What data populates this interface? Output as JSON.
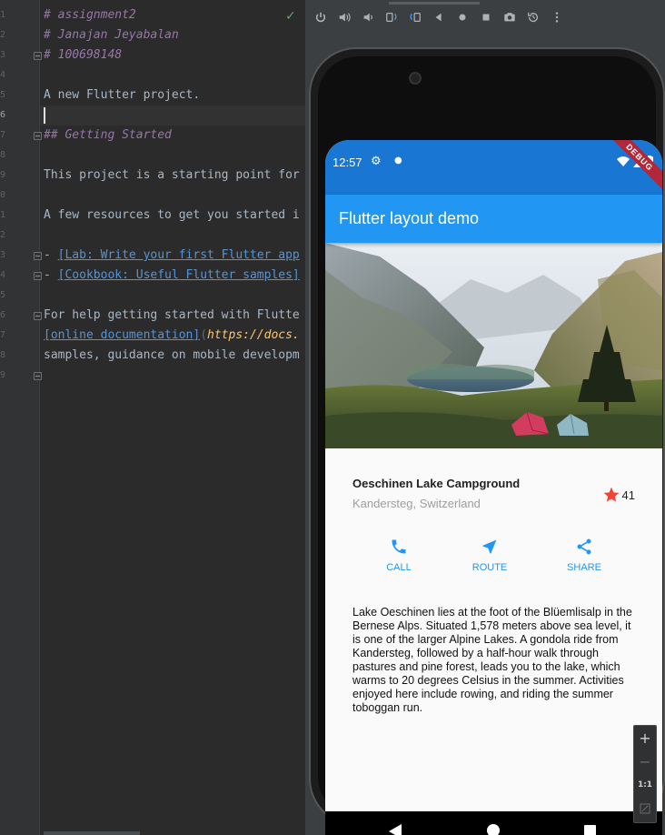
{
  "editor": {
    "line_numbers": [
      "1",
      "2",
      "3",
      "4",
      "5",
      "6",
      "7",
      "8",
      "9",
      "0",
      "1",
      "2",
      "3",
      "4",
      "5",
      "6",
      "7",
      "8",
      "9"
    ],
    "lines": {
      "l1": "# assignment2",
      "l2": "# Janajan Jeyabalan",
      "l3": "# 100698148",
      "l5": "A new Flutter project.",
      "l7": "## Getting Started",
      "l9": "This project is a starting point for",
      "l11": "A few resources to get you started i",
      "l13_prefix": "- ",
      "l13_link": "[Lab: Write your first Flutter app",
      "l14_prefix": "- ",
      "l14_link": "[Cookbook: Useful Flutter samples]",
      "l16": "For help getting started with Flutte",
      "l17_link": "[online documentation]",
      "l17_paren": "(",
      "l17_url": "https://docs.",
      "l18": "samples, guidance on mobile developm"
    },
    "status_icon": "checkmark-icon"
  },
  "emulator": {
    "toolbar": [
      "power-icon",
      "volume-up-icon",
      "volume-down-icon",
      "rotate-left-icon",
      "rotate-right-icon",
      "back-icon",
      "home-icon",
      "overview-icon",
      "screenshot-icon",
      "snapshot-icon",
      "more-icon"
    ]
  },
  "phone": {
    "status_time": "12:57",
    "debug_banner": "DEBUG",
    "appbar_title": "Flutter layout demo",
    "place_name": "Oeschinen Lake Campground",
    "place_location": "Kandersteg, Switzerland",
    "favorite_count": "41",
    "actions": [
      {
        "label": "CALL",
        "icon": "phone-icon"
      },
      {
        "label": "ROUTE",
        "icon": "navigation-icon"
      },
      {
        "label": "SHARE",
        "icon": "share-icon"
      }
    ],
    "description": "Lake Oeschinen lies at the foot of the Blüemlisalp in the Bernese Alps. Situated 1,578 meters above sea level, it is one of the larger Alpine Lakes. A gondola ride from Kandersteg, followed by a half-hour walk through pastures and pine forest, leads you to the lake, which warms to 20 degrees Celsius in the summer. Activities enjoyed here include rowing, and riding the summer toboggan run.",
    "colors": {
      "accent": "#2196f3",
      "status": "#1976d2",
      "star": "#f44336"
    }
  },
  "zoom_controls": {
    "zoom_in": "+",
    "zoom_out": "−",
    "actual_size": "1:1"
  }
}
